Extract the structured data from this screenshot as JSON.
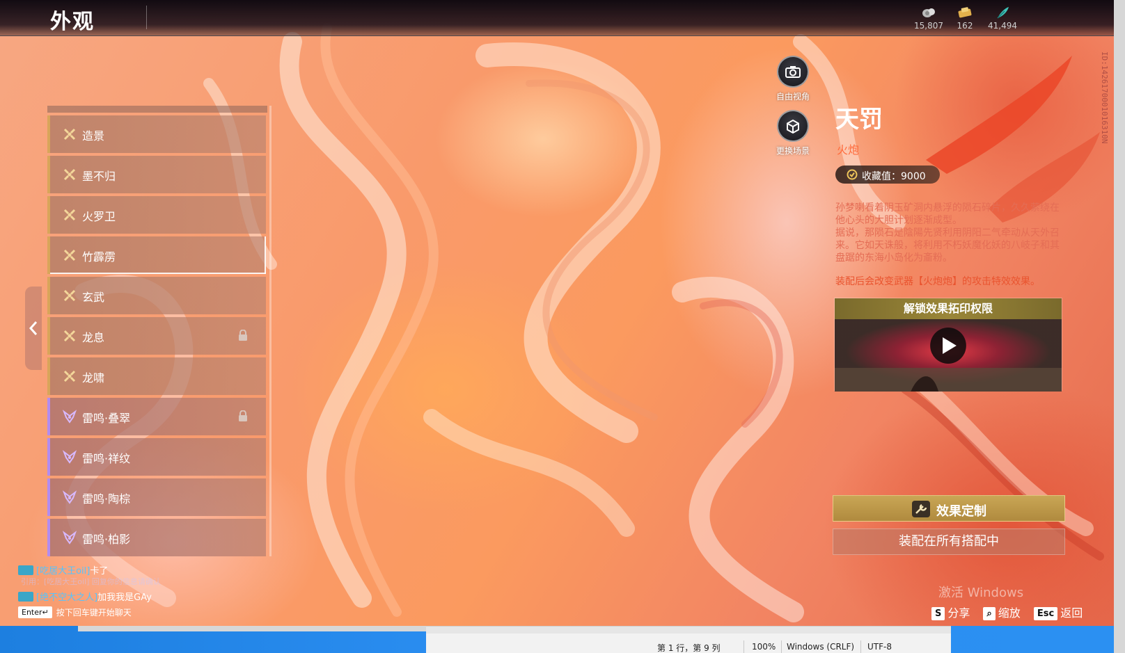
{
  "header": {
    "title": "外观",
    "currencies": [
      {
        "icon": "coin-bag-icon",
        "value": "15,807"
      },
      {
        "icon": "gold-ticket-icon",
        "value": "162"
      },
      {
        "icon": "feather-icon",
        "value": "41,494"
      }
    ]
  },
  "sidebar": {
    "items": [
      {
        "label": "造景",
        "icon": "gold-cross-icon",
        "rarity": "gold",
        "locked": false
      },
      {
        "label": "墨不归",
        "icon": "gold-cross-icon",
        "rarity": "gold",
        "locked": false
      },
      {
        "label": "火罗卫",
        "icon": "gold-cross-icon",
        "rarity": "gold",
        "locked": false
      },
      {
        "label": "竹霹雳",
        "icon": "gold-cross-icon",
        "rarity": "gold",
        "locked": false
      },
      {
        "label": "玄武",
        "icon": "gold-cross-icon",
        "rarity": "gold",
        "locked": false
      },
      {
        "label": "龙息",
        "icon": "gold-cross-icon",
        "rarity": "gold",
        "locked": true
      },
      {
        "label": "龙啸",
        "icon": "gold-cross-icon",
        "rarity": "gold",
        "locked": false
      },
      {
        "label": "雷鸣·叠翠",
        "icon": "purple-wing-icon",
        "rarity": "purple",
        "locked": true
      },
      {
        "label": "雷鸣·祥纹",
        "icon": "purple-wing-icon",
        "rarity": "purple",
        "locked": false
      },
      {
        "label": "雷鸣·陶棕",
        "icon": "purple-wing-icon",
        "rarity": "purple",
        "locked": false
      },
      {
        "label": "雷鸣·柏影",
        "icon": "purple-wing-icon",
        "rarity": "purple",
        "locked": false
      }
    ]
  },
  "view_buttons": {
    "free_view": "自由视角",
    "change_scene": "更换场景"
  },
  "detail": {
    "name": "天罚",
    "weapon": "火炮",
    "collect_value": "收藏值：9000",
    "description": [
      "孙梦喇看着阴玉矿洞内悬浮的陨石碎片，久久萦绕在他心头的大胆计划逐渐成型。",
      "据说，那陨石是陰陽先贤利用阴阳二气牵动从天外召来。它如天诛般，将利用不朽妖魔化妖的八岐子和其盘踞的东海小岛化为齑粉。"
    ],
    "bonus": "装配后会改变武器【火炮炮】的攻击特效效果。",
    "preview_title": "解锁效果拓印权限",
    "customize_label": "效果定制",
    "equip_label": "装配在所有搭配中",
    "id_text": "ID:1426170001016310N"
  },
  "chat": {
    "messages": [
      {
        "name": "[吃居大王oil]",
        "text": "卡了"
      },
      {
        "name": "[绝不空大之人]",
        "text": "加我我是GAy"
      }
    ],
    "faded_line": "引用：[吃居大王oil] 回复你的信息请确认",
    "enter_key": "Enter↵",
    "input_hint": "按下回车键开始聊天"
  },
  "hints": [
    {
      "key": "S",
      "label": "分享"
    },
    {
      "key": "⌕",
      "label": "缩放"
    },
    {
      "key": "Esc",
      "label": "返回"
    }
  ],
  "watermark": "激活 Windows",
  "editor_status": {
    "position": "第 1 行，第 9 列",
    "zoom": "100%",
    "line_ending": "Windows (CRLF)",
    "encoding": "UTF-8"
  },
  "colors": {
    "gold_rarity": "#d8a55a",
    "purple_rarity": "#b38cf0",
    "weapon_text": "#ff6a3b",
    "customize_button": "#c9a655",
    "chat_name": "#54c4ff"
  }
}
